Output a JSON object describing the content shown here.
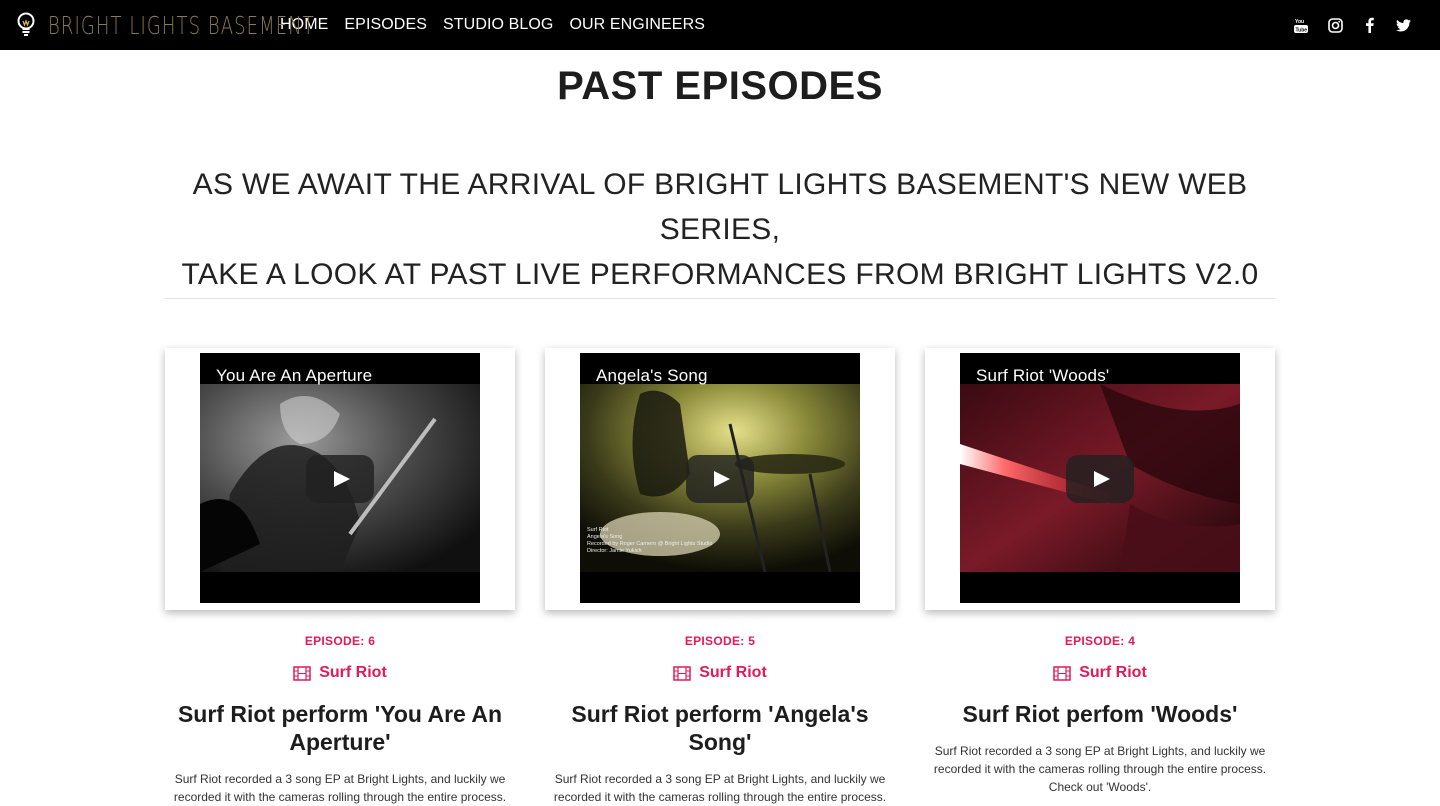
{
  "nav": {
    "brand": "BRIGHT LIGHTS BASEMENT",
    "links": [
      "HOME",
      "EPISODES",
      "STUDIO BLOG",
      "OUR ENGINEERS"
    ],
    "social_icons": [
      "youtube-icon",
      "instagram-icon",
      "facebook-icon",
      "twitter-icon"
    ]
  },
  "page": {
    "title": "PAST EPISODES",
    "subtitle_line1": "AS WE AWAIT THE ARRIVAL OF BRIGHT LIGHTS BASEMENT'S NEW WEB SERIES,",
    "subtitle_line2": "TAKE A LOOK AT PAST LIVE PERFORMANCES FROM BRIGHT LIGHTS V2.0"
  },
  "episodes": [
    {
      "video_title": "You Are An Aperture",
      "episode": "EPISODE: 6",
      "band": "Surf Riot",
      "title": "Surf Riot perform 'You Are An Aperture'",
      "desc": "Surf Riot recorded a 3 song EP at Bright Lights, and luckily we recorded it with the cameras rolling through the entire process."
    },
    {
      "video_title": "Angela's Song",
      "episode": "EPISODE: 5",
      "band": "Surf Riot",
      "title": "Surf Riot perform 'Angela's Song'",
      "desc": "Surf Riot recorded a 3 song EP at Bright Lights, and luckily we recorded it with the cameras rolling through the entire process.",
      "credits": [
        "Surf Riot",
        "Angela's Song",
        "Recorded by Roger Carnero @ Bright Lights Studio",
        "Director: Jamie Yukich"
      ]
    },
    {
      "video_title": "Surf Riot 'Woods'",
      "episode": "EPISODE: 4",
      "band": "Surf Riot",
      "title": "Surf Riot perfom 'Woods'",
      "desc": "Surf Riot recorded a 3 song EP at Bright Lights, and luckily we recorded it with the cameras rolling through the entire process. Check out 'Woods'."
    }
  ],
  "colors": {
    "accent": "#e3195a",
    "navbar": "#000000",
    "brand_gold": "#8a7a52"
  }
}
